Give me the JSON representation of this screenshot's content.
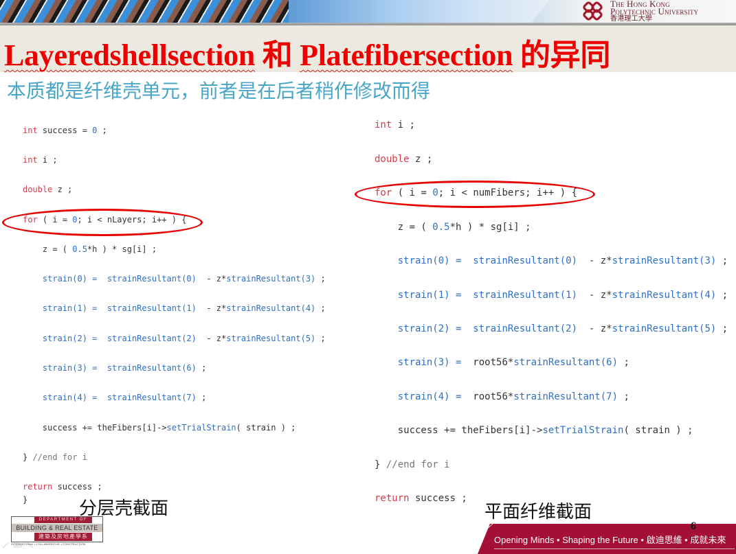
{
  "header": {
    "university_name_line1": "The Hong Kong",
    "university_name_line2": "Polytechnic University",
    "university_name_zh": "香港理工大學",
    "title_part1": "Layeredshellsection",
    "title_conj": " 和 ",
    "title_part2": "Platefibersection",
    "title_suffix": " 的异同",
    "subtitle": "本质都是纤维壳单元，前者是在后者稍作修改而得"
  },
  "left_code": {
    "lines": [
      [
        {
          "t": "int",
          "c": "kw"
        },
        {
          "t": " success = ",
          "c": ""
        },
        {
          "t": "0",
          "c": "num"
        },
        {
          "t": " ;",
          "c": ""
        }
      ],
      [
        {
          "t": "int",
          "c": "kw"
        },
        {
          "t": " i ;",
          "c": ""
        }
      ],
      [
        {
          "t": "double",
          "c": "kw"
        },
        {
          "t": " z ;",
          "c": ""
        }
      ],
      [
        {
          "t": "for",
          "c": "kw"
        },
        {
          "t": " ( i = ",
          "c": ""
        },
        {
          "t": "0",
          "c": "num"
        },
        {
          "t": "; i < nLayers; i++ ) {",
          "c": ""
        }
      ],
      [
        {
          "t": "    z = ( ",
          "c": ""
        },
        {
          "t": "0.5",
          "c": "num"
        },
        {
          "t": "*h ) * sg[i] ;",
          "c": ""
        }
      ],
      [
        {
          "t": "    strain(0) =  ",
          "c": "fn"
        },
        {
          "t": "strainResultant(0)",
          "c": "fn"
        },
        {
          "t": "  - z*",
          "c": ""
        },
        {
          "t": "strainResultant(3)",
          "c": "fn"
        },
        {
          "t": " ;",
          "c": ""
        }
      ],
      [
        {
          "t": "    strain(1) =  ",
          "c": "fn"
        },
        {
          "t": "strainResultant(1)",
          "c": "fn"
        },
        {
          "t": "  - z*",
          "c": ""
        },
        {
          "t": "strainResultant(4)",
          "c": "fn"
        },
        {
          "t": " ;",
          "c": ""
        }
      ],
      [
        {
          "t": "    strain(2) =  ",
          "c": "fn"
        },
        {
          "t": "strainResultant(2)",
          "c": "fn"
        },
        {
          "t": "  - z*",
          "c": ""
        },
        {
          "t": "strainResultant(5)",
          "c": "fn"
        },
        {
          "t": " ;",
          "c": ""
        }
      ],
      [
        {
          "t": "    strain(3) =  ",
          "c": "fn"
        },
        {
          "t": "strainResultant(6)",
          "c": "fn"
        },
        {
          "t": " ;",
          "c": ""
        }
      ],
      [
        {
          "t": "    strain(4) =  ",
          "c": "fn"
        },
        {
          "t": "strainResultant(7)",
          "c": "fn"
        },
        {
          "t": " ;",
          "c": ""
        }
      ],
      [
        {
          "t": "    success += theFibers[i]->",
          "c": ""
        },
        {
          "t": "setTrialStrain",
          "c": "fn"
        },
        {
          "t": "( strain ) ;",
          "c": ""
        }
      ],
      [
        {
          "t": "} ",
          "c": ""
        },
        {
          "t": "//end for i",
          "c": "cm"
        }
      ],
      [
        {
          "t": "return",
          "c": "kw"
        },
        {
          "t": " success ;",
          "c": ""
        }
      ],
      [
        {
          "t": "}",
          "c": ""
        }
      ]
    ]
  },
  "right_code": {
    "lines": [
      [
        {
          "t": "int",
          "c": "kw"
        },
        {
          "t": " i ;",
          "c": ""
        }
      ],
      [
        {
          "t": "double",
          "c": "kw"
        },
        {
          "t": " z ;",
          "c": ""
        }
      ],
      [
        {
          "t": "for",
          "c": "kw"
        },
        {
          "t": " ( i = ",
          "c": ""
        },
        {
          "t": "0",
          "c": "num"
        },
        {
          "t": "; i < numFibers; i++ ) {",
          "c": ""
        }
      ],
      [
        {
          "t": "    z = ( ",
          "c": ""
        },
        {
          "t": "0.5",
          "c": "num"
        },
        {
          "t": "*h ) * sg[i] ;",
          "c": ""
        }
      ],
      [
        {
          "t": "    strain(0) =  ",
          "c": "fn"
        },
        {
          "t": "strainResultant(0)",
          "c": "fn"
        },
        {
          "t": "  - z*",
          "c": ""
        },
        {
          "t": "strainResultant(3)",
          "c": "fn"
        },
        {
          "t": " ;",
          "c": ""
        }
      ],
      [
        {
          "t": "    strain(1) =  ",
          "c": "fn"
        },
        {
          "t": "strainResultant(1)",
          "c": "fn"
        },
        {
          "t": "  - z*",
          "c": ""
        },
        {
          "t": "strainResultant(4)",
          "c": "fn"
        },
        {
          "t": " ;",
          "c": ""
        }
      ],
      [
        {
          "t": "    strain(2) =  ",
          "c": "fn"
        },
        {
          "t": "strainResultant(2)",
          "c": "fn"
        },
        {
          "t": "  - z*",
          "c": ""
        },
        {
          "t": "strainResultant(5)",
          "c": "fn"
        },
        {
          "t": " ;",
          "c": ""
        }
      ],
      [
        {
          "t": "    strain(3) =  ",
          "c": "fn"
        },
        {
          "t": "root56*",
          "c": ""
        },
        {
          "t": "strainResultant(6)",
          "c": "fn"
        },
        {
          "t": " ;",
          "c": ""
        }
      ],
      [
        {
          "t": "    strain(4) =  ",
          "c": "fn"
        },
        {
          "t": "root56*",
          "c": ""
        },
        {
          "t": "strainResultant(7)",
          "c": "fn"
        },
        {
          "t": " ;",
          "c": ""
        }
      ],
      [
        {
          "t": "    success += theFibers[i]->",
          "c": ""
        },
        {
          "t": "setTrialStrain",
          "c": "fn"
        },
        {
          "t": "( strain ) ;",
          "c": ""
        }
      ],
      [
        {
          "t": "} ",
          "c": ""
        },
        {
          "t": "//end for i",
          "c": "cm"
        }
      ],
      [
        {
          "t": "return",
          "c": "kw"
        },
        {
          "t": " success ;",
          "c": ""
        }
      ]
    ]
  },
  "captions": {
    "left": "分层壳截面",
    "right": "平面纤维截面"
  },
  "footer": {
    "dept_line1": "DEPARTMENT OF",
    "dept_line2": "BUILDING & REAL ESTATE",
    "dept_line3": "建築及房地產學系",
    "dept_tagline": "INTERNATIONAL • COLLABORATIVE • CONSTRUCTION",
    "slogan": "Opening Minds • Shaping the Future • 啟迪思維 • 成就未來",
    "page_number": "6"
  },
  "colors": {
    "title": "#ee0000",
    "subtitle": "#4aa6c6",
    "keyword": "#d43a4a",
    "function": "#2f6fc4",
    "footer_band": "#a40f35",
    "highlight_ellipse": "#e60000"
  }
}
